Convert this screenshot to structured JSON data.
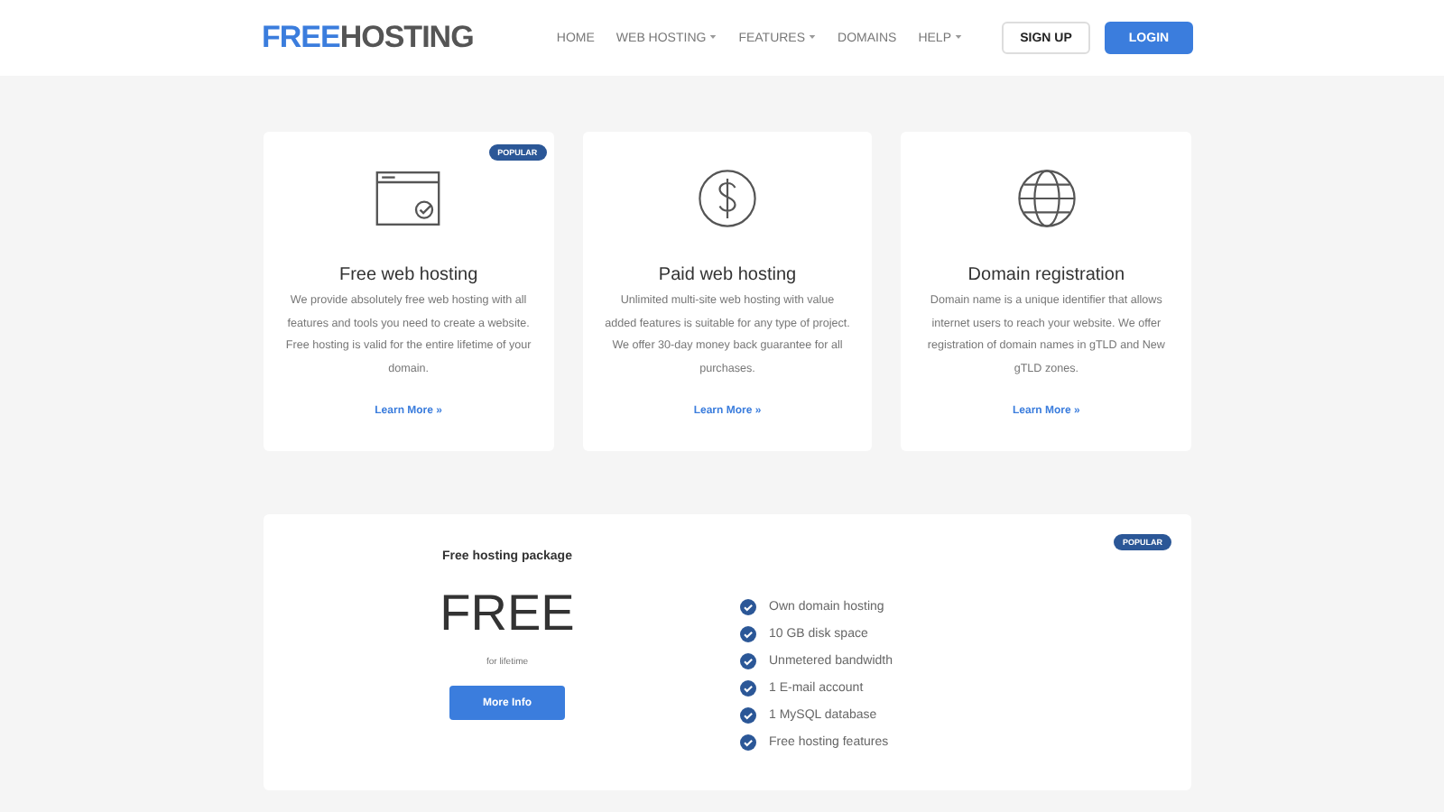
{
  "header": {
    "logo": {
      "highlight": "FREE",
      "rest": "HOSTING"
    },
    "nav": [
      {
        "label": "HOME",
        "dropdown": false
      },
      {
        "label": "WEB HOSTING",
        "dropdown": true
      },
      {
        "label": "FEATURES",
        "dropdown": true
      },
      {
        "label": "DOMAINS",
        "dropdown": false
      },
      {
        "label": "HELP",
        "dropdown": true
      }
    ],
    "buttons": [
      {
        "label": "SIGN UP",
        "kind": "outline"
      },
      {
        "label": "LOGIN",
        "kind": "primary"
      }
    ]
  },
  "cards": [
    {
      "kind": "browser",
      "badge": "POPULAR",
      "title": "Free web hosting",
      "text": "We provide absolutely free web hosting with all features and tools you need to create a website. Free hosting is valid for the entire lifetime of your domain.",
      "link": "Learn More »"
    },
    {
      "kind": "dollar",
      "title": "Paid web hosting",
      "text": "Unlimited multi-site web hosting with value added features is suitable for any type of project. We offer 30-day money back guarantee for all purchases.",
      "link": "Learn More »"
    },
    {
      "kind": "globe",
      "title": "Domain registration",
      "text": "Domain name is a unique identifier that allows internet users to reach your website. We offer registration of domain names in gTLD and New gTLD zones.",
      "link": "Learn More »"
    }
  ],
  "package": {
    "badge": "POPULAR",
    "title": "Free hosting package",
    "price": "FREE",
    "period": "for lifetime",
    "button": "More Info",
    "features": [
      "Own domain hosting",
      "10 GB disk space",
      "Unmetered bandwidth",
      "1 E-mail account",
      "1 MySQL database",
      "Free hosting features"
    ]
  }
}
